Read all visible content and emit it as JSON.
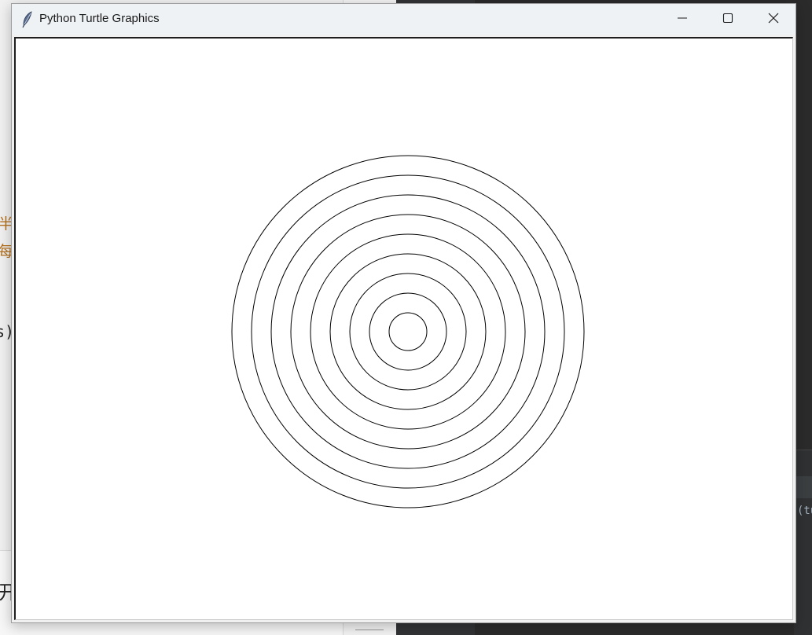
{
  "window": {
    "title": "Python Turtle Graphics",
    "icon": "feather-icon",
    "controls": [
      "minimize-icon",
      "maximize-icon",
      "close-icon"
    ]
  },
  "canvas": {
    "background": "#ffffff",
    "stroke_color": "#000000",
    "drawing": "concentric circles",
    "circle_count": 9
  },
  "background_fragments": {
    "left_chars": [
      "半",
      "每",
      "s)",
      "开"
    ],
    "editor_text": "(tu"
  },
  "colors": {
    "editor_bg": "#2b2b2b",
    "titlebar_bg": "#eef2f5",
    "fragment_orange": "#b4701e"
  }
}
